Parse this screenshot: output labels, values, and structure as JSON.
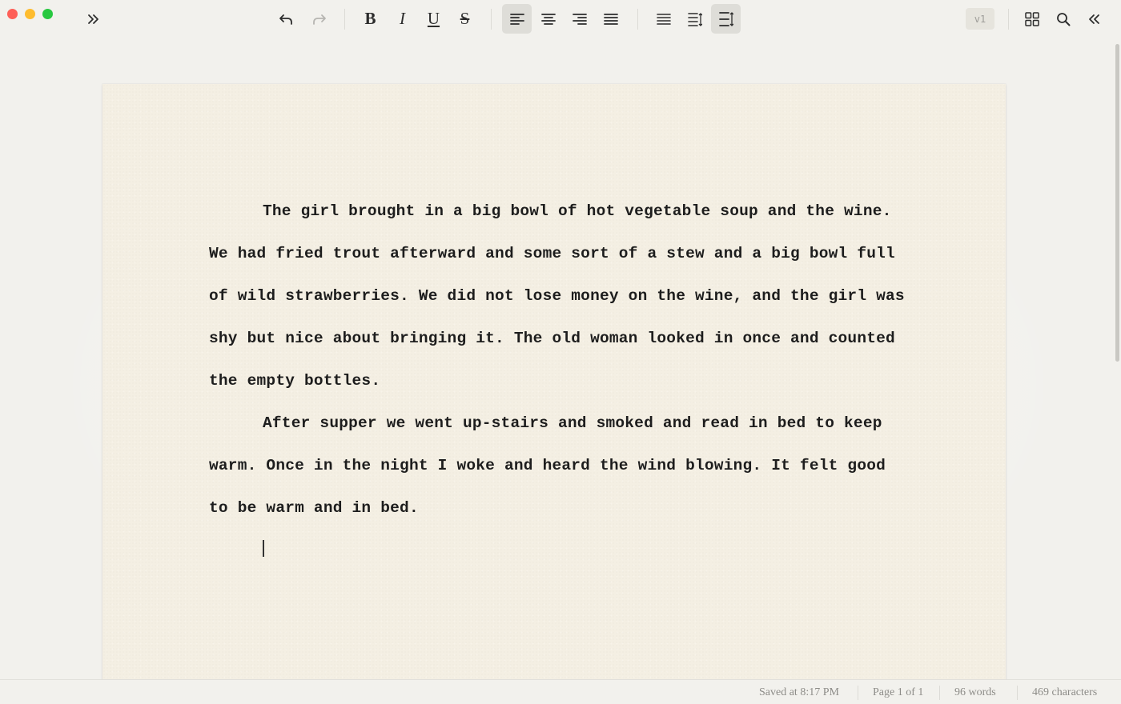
{
  "toolbar": {
    "expand_icon": "chevron-double-right-icon",
    "undo_icon": "undo-icon",
    "redo_icon": "redo-icon",
    "bold_label": "B",
    "italic_label": "I",
    "underline_label": "U",
    "strike_label": "S",
    "align_left_icon": "align-left-icon",
    "align_center_icon": "align-center-icon",
    "align_right_icon": "align-right-icon",
    "justify_icon": "align-justify-icon",
    "version_label": "v1",
    "grid_icon": "grid-icon",
    "search_icon": "search-icon",
    "collapse_icon": "chevron-double-left-icon"
  },
  "document": {
    "paragraphs": [
      "The girl brought in a big bowl of hot vegetable soup and the wine. We had fried trout afterward and some sort of a stew and a big bowl full of wild strawberries. We did not lose money on the wine, and the girl was shy but nice about bringing it. The old woman looked in once and counted the empty bottles.",
      "After supper we went up-stairs and smoked and read in bed to keep warm. Once in the night I woke and heard the wind blowing. It felt good to be warm and in bed."
    ]
  },
  "status": {
    "saved": "Saved at 8:17 PM",
    "page": "Page 1 of 1",
    "words": "96 words",
    "characters": "469 characters"
  },
  "colors": {
    "window_bg": "#f2f1ed",
    "paper": "#f4efe3",
    "text": "#1d1d1d",
    "active_button": "#deddd8"
  }
}
